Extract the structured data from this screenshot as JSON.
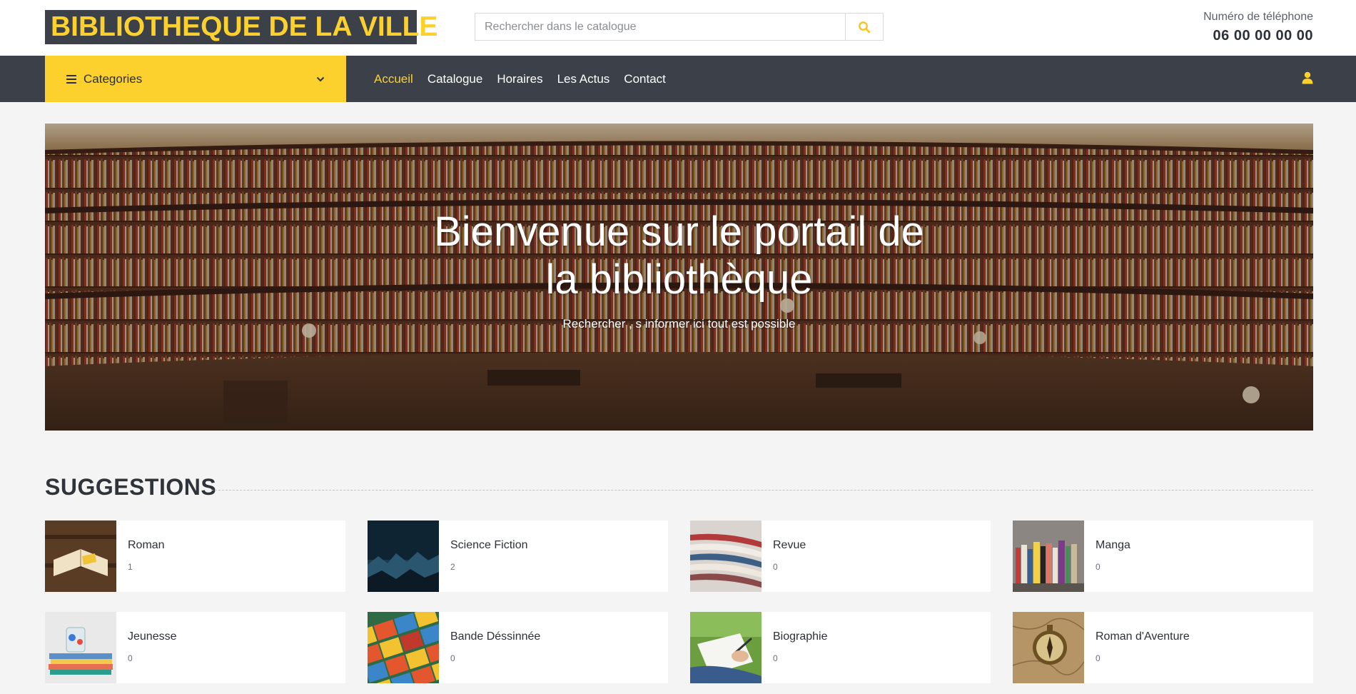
{
  "header": {
    "logo": "BIBLIOTHEQUE DE LA VILLE",
    "search_placeholder": "Rechercher dans le catalogue",
    "phone_label": "Numéro de téléphone",
    "phone_number": "06 00 00 00 00"
  },
  "nav": {
    "categories_label": "Categories",
    "links": [
      "Accueil",
      "Catalogue",
      "Horaires",
      "Les Actus",
      "Contact"
    ],
    "active": "Accueil"
  },
  "hero": {
    "title_line1": "Bienvenue sur le portail de",
    "title_line2": "la bibliothèque",
    "subtitle": "Rechercher , s informer ici tout est possible"
  },
  "suggestions": {
    "title": "SUGGESTIONS",
    "items": [
      {
        "name": "Roman",
        "count": "1"
      },
      {
        "name": "Science Fiction",
        "count": "2"
      },
      {
        "name": "Revue",
        "count": "0"
      },
      {
        "name": "Manga",
        "count": "0"
      },
      {
        "name": "Jeunesse",
        "count": "0"
      },
      {
        "name": "Bande Déssinnée",
        "count": "0"
      },
      {
        "name": "Biographie",
        "count": "0"
      },
      {
        "name": "Roman d'Aventure",
        "count": "0"
      }
    ]
  },
  "colors": {
    "accent": "#fcd12e",
    "dark": "#3b4049",
    "background": "#f4f4f4"
  },
  "icons": {
    "search": "search-icon",
    "menu": "hamburger-icon",
    "chevron": "chevron-down-icon",
    "user": "user-icon"
  }
}
